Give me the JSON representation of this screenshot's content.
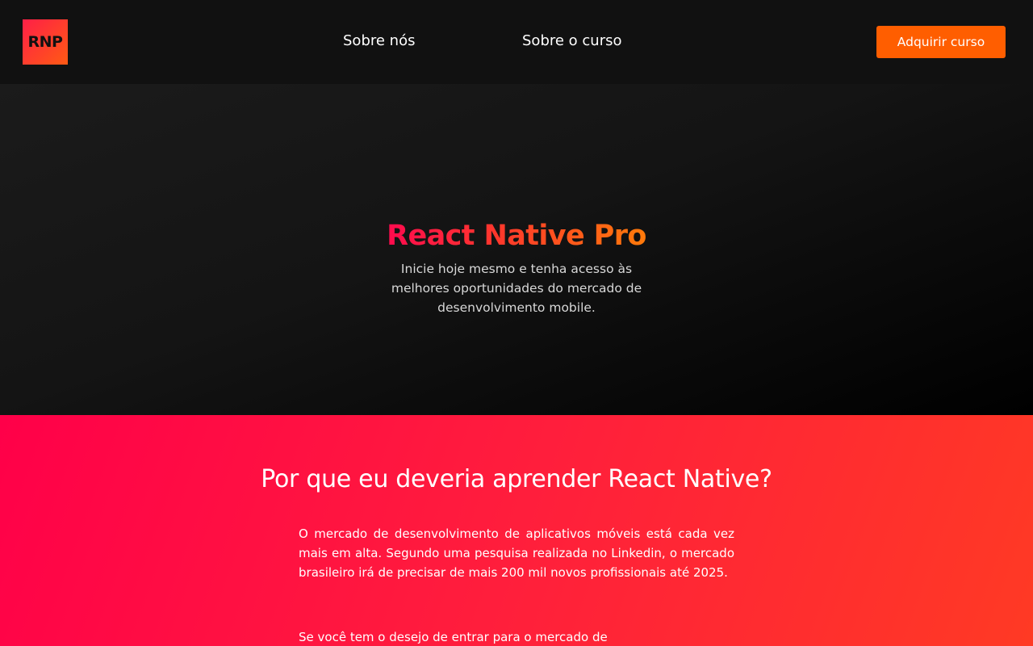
{
  "header": {
    "logo_text": "RNP",
    "nav": {
      "about": "Sobre nós",
      "course": "Sobre o curso"
    },
    "buy_button": "Adquirir curso"
  },
  "hero": {
    "title": "React Native Pro",
    "subtitle": "Inicie hoje mesmo e tenha acesso às melhores oportunidades do mercado de desenvolvimento mobile."
  },
  "why": {
    "title": "Por que eu deveria aprender React Native?",
    "paragraphs": [
      "O mercado de desenvolvimento de aplicativos móveis está cada vez mais em alta. Segundo uma pesquisa realizada no Linkedin, o mercado brasileiro irá de precisar de mais 200 mil novos profissionais até 2025.",
      "Se você tem o desejo de entrar para o mercado de"
    ]
  },
  "colors": {
    "accent_orange": "#ff5e00",
    "accent_pink": "#ff0a4e",
    "background_dark": "#111111"
  }
}
